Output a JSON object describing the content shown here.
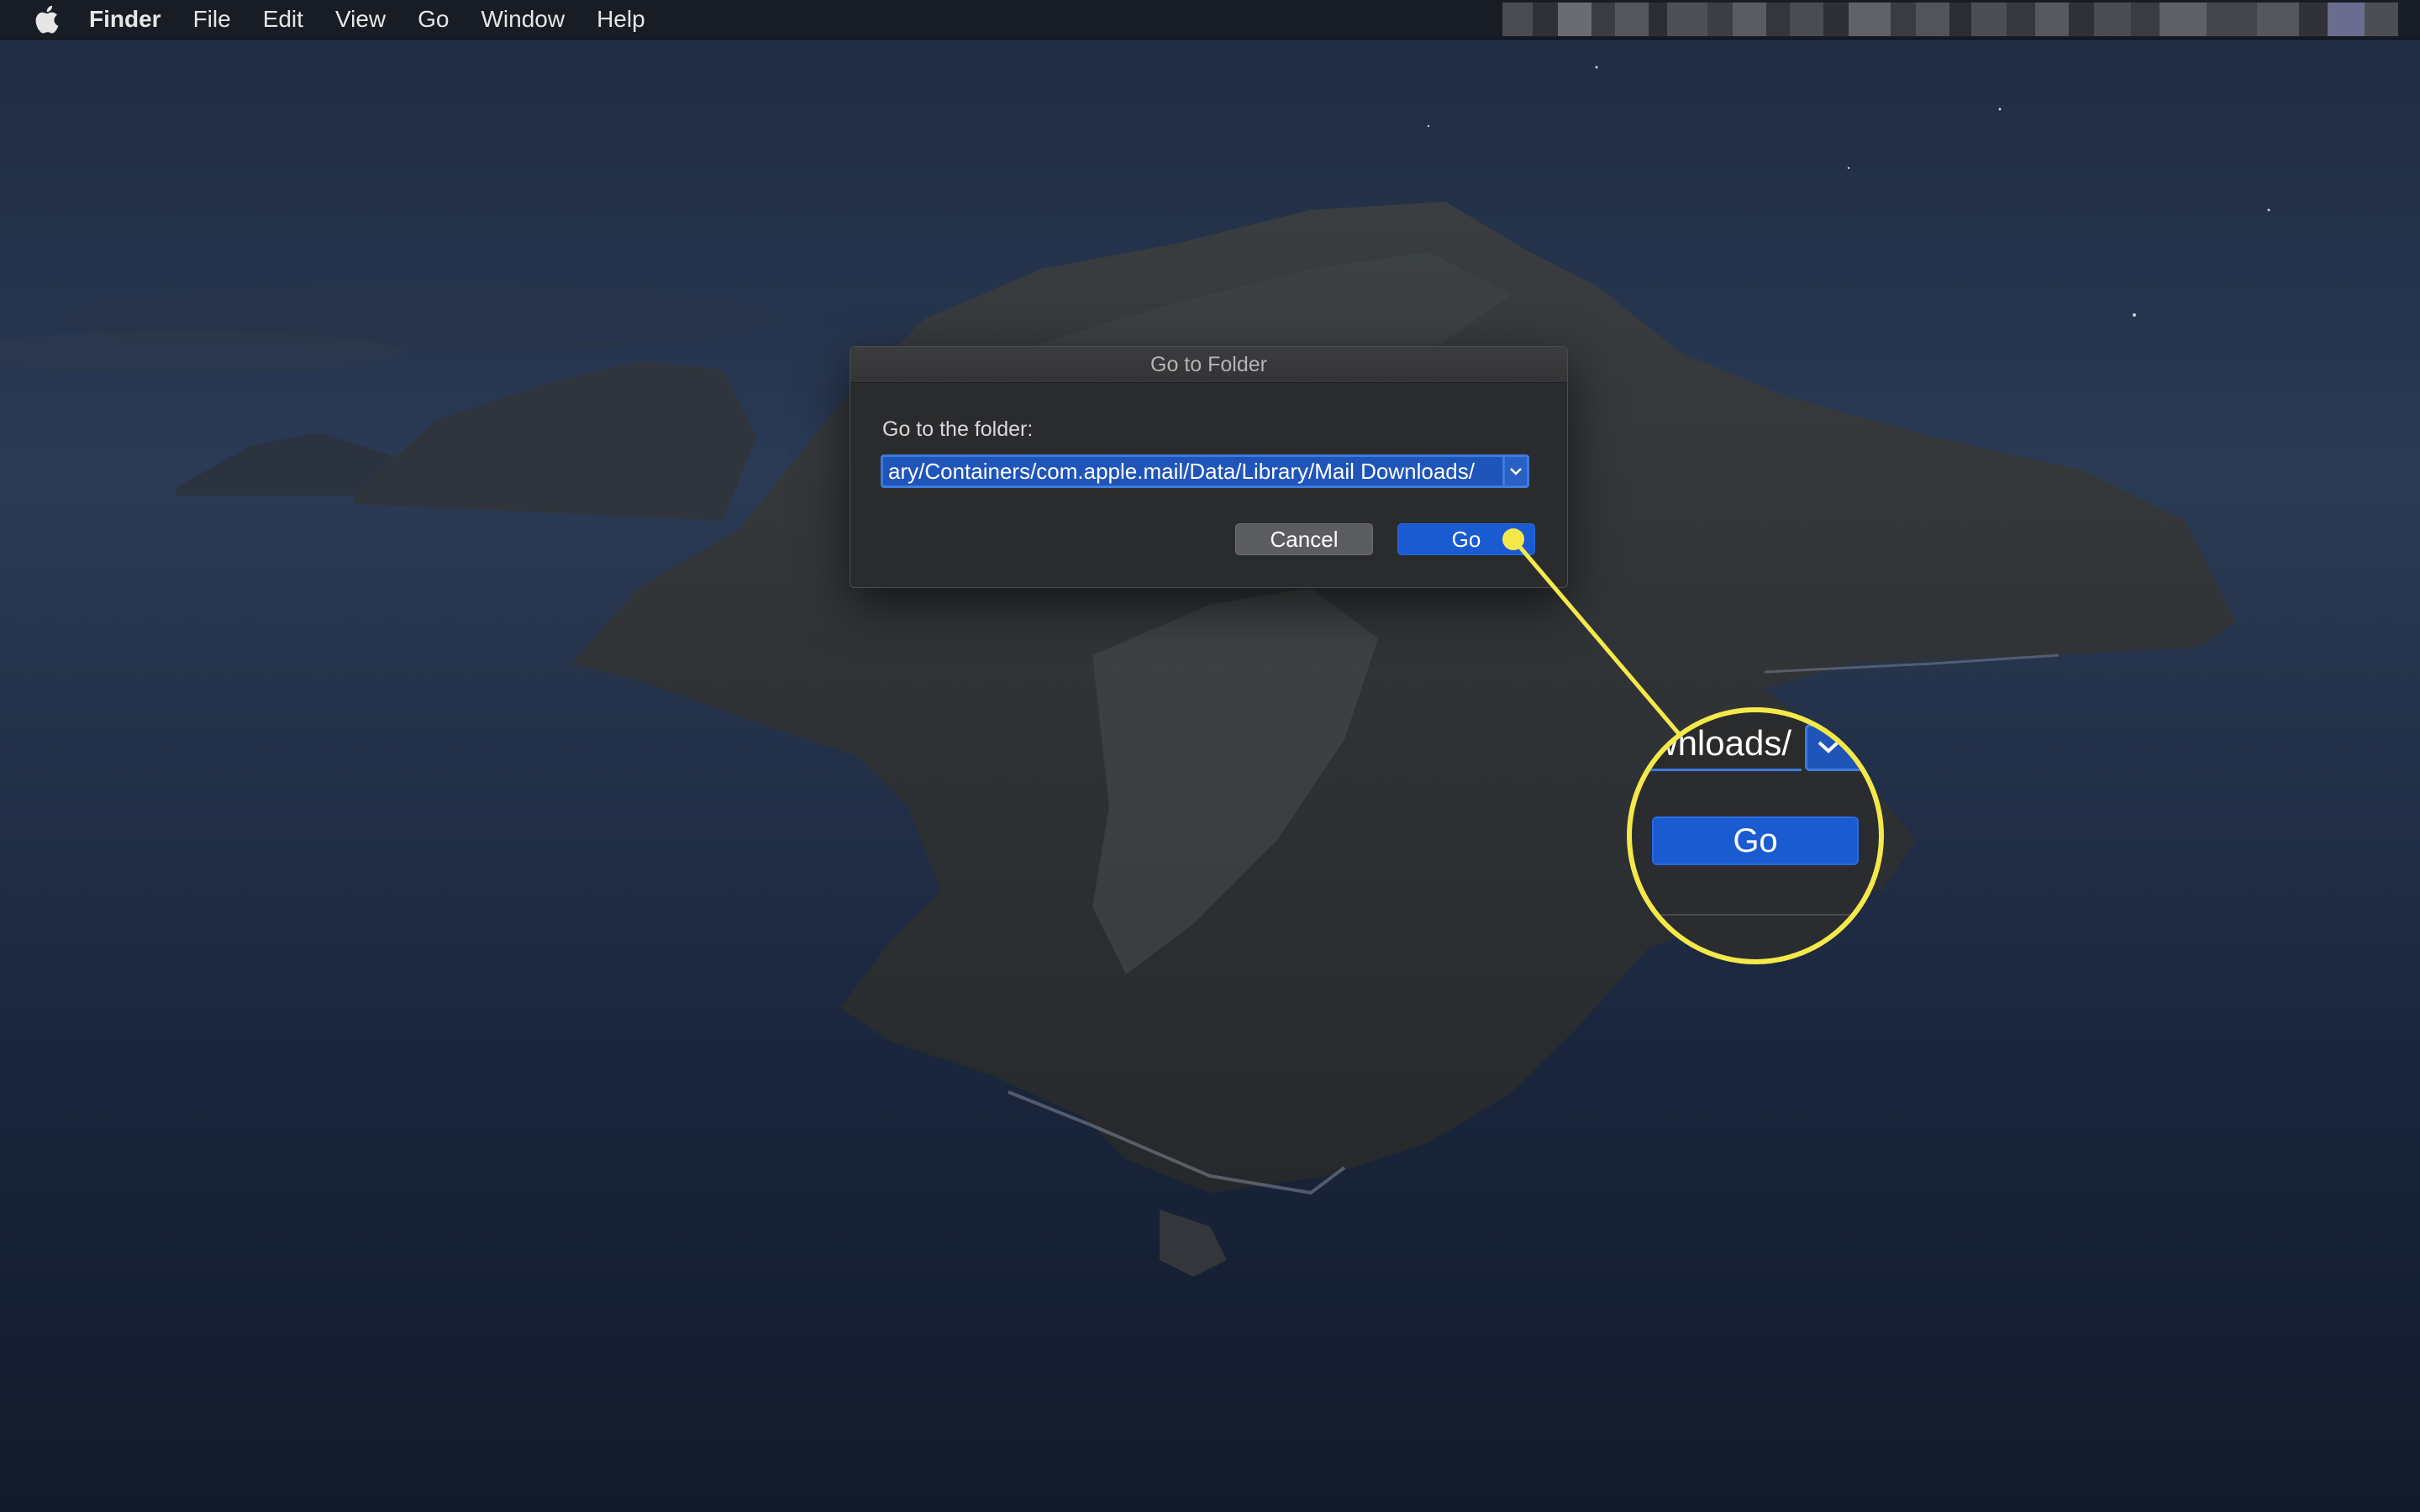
{
  "menubar": {
    "app_name": "Finder",
    "items": [
      "File",
      "Edit",
      "View",
      "Go",
      "Window",
      "Help"
    ]
  },
  "dialog": {
    "title": "Go to Folder",
    "label": "Go to the folder:",
    "path_value": "ary/Containers/com.apple.mail/Data/Library/Mail Downloads/",
    "cancel_label": "Cancel",
    "go_label": "Go"
  },
  "callout": {
    "zoom_path_text": "wnloads/",
    "zoom_go_label": "Go",
    "color": "#f5e94a"
  },
  "colors": {
    "accent": "#1a5bd2",
    "callout": "#f5e94a"
  }
}
